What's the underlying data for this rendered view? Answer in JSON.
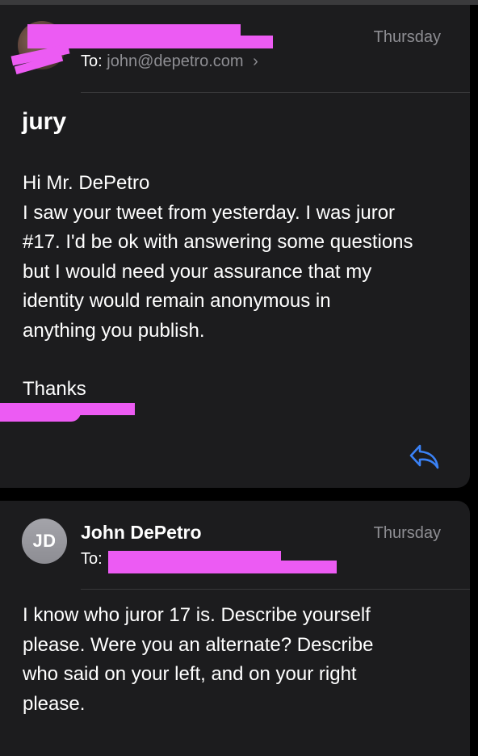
{
  "message1": {
    "date": "Thursday",
    "to_label": "To:",
    "to_address": "john@depetro.com",
    "subject": "jury",
    "body_lines": [
      "Hi Mr. DePetro",
      "I saw your tweet from yesterday. I was juror",
      "#17. I'd be ok with answering some questions",
      "but I would need your assurance that my",
      "identity would remain anonymous in",
      "anything you publish."
    ],
    "closing": "Thanks"
  },
  "message2": {
    "avatar_initials": "JD",
    "sender": "John DePetro",
    "date": "Thursday",
    "to_label": "To:",
    "body_lines": [
      "I know who juror 17 is. Describe yourself",
      "please. Were you an alternate?  Describe",
      "who said on your left, and on your right",
      "please."
    ]
  },
  "colors": {
    "background": "#000000",
    "card": "#1c1c1e",
    "secondary_text": "#8e8e93",
    "accent_blue": "#3a82f7",
    "redaction": "#ec5bf3"
  },
  "icons": [
    "reply-icon",
    "chevron-right-icon"
  ]
}
